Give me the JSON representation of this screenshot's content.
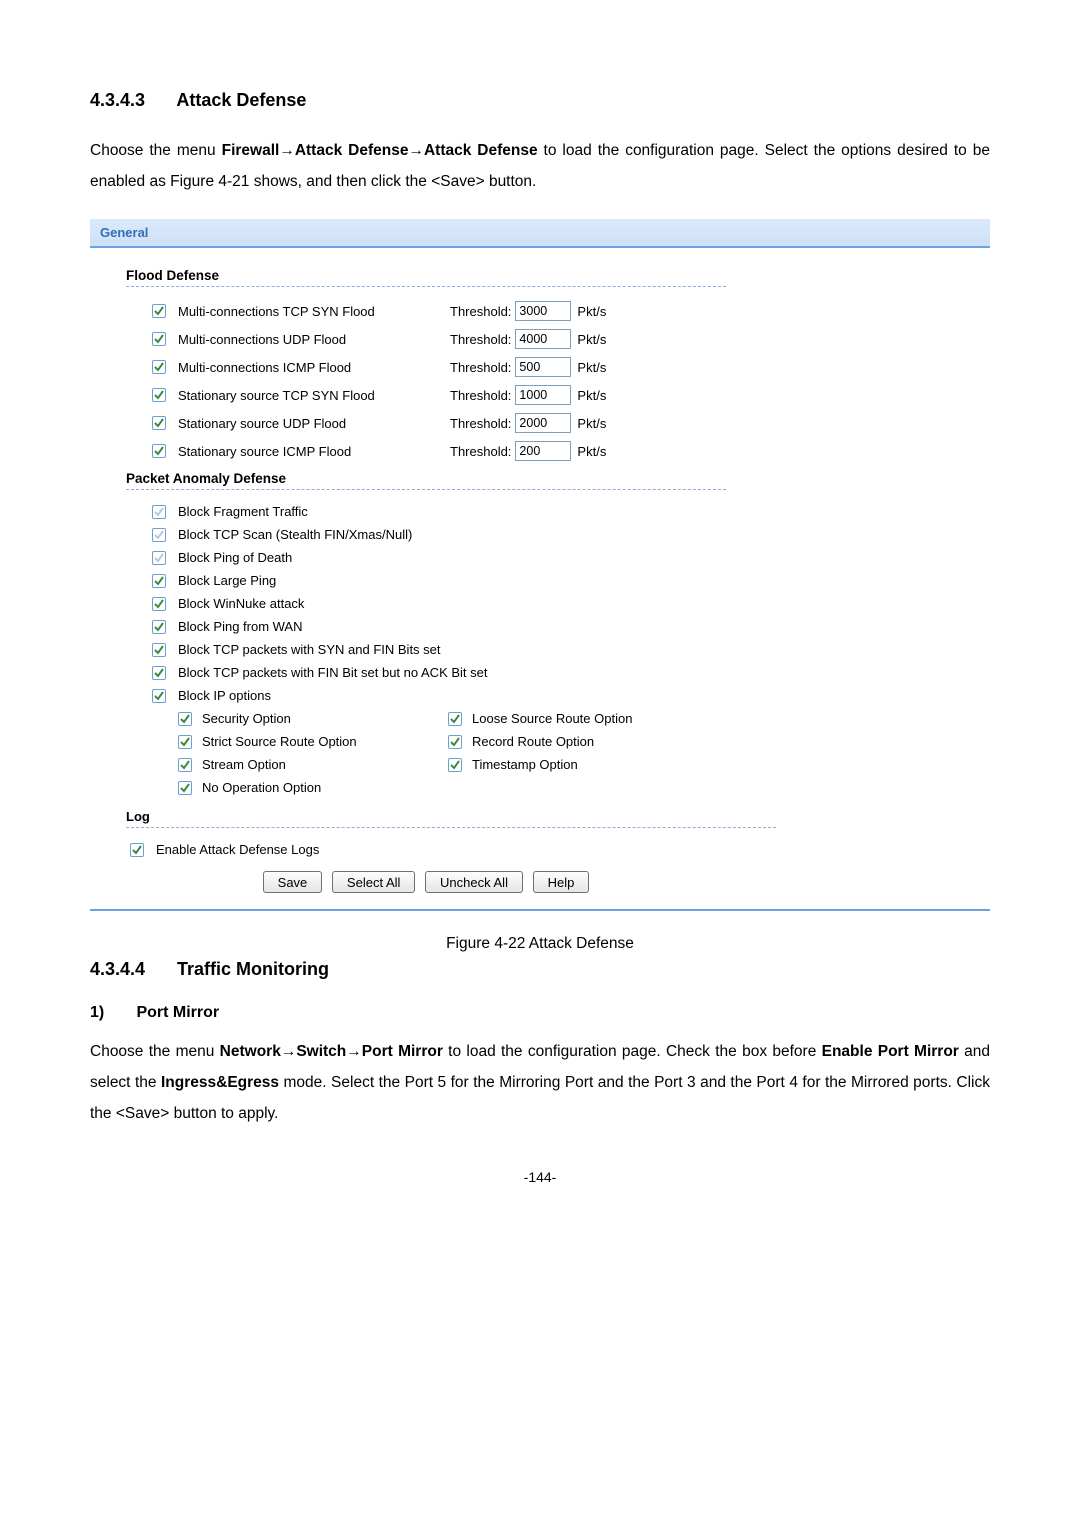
{
  "section1": {
    "number": "4.3.4.3",
    "title": "Attack Defense"
  },
  "para1_a": "Choose the menu ",
  "para1_b": "Firewall",
  "para1_arrow": "→",
  "para1_c": "Attack Defense",
  "para1_d": "Attack Defense",
  "para1_e": " to load the configuration page. Select the options desired to be enabled as Figure 4-21 shows, and then click the <Save> button.",
  "panel": {
    "general": "General",
    "flood_title": "Flood Defense",
    "flood": [
      {
        "label": "Multi-connections TCP SYN Flood",
        "threshold_label": "Threshold:",
        "value": "3000",
        "unit": "Pkt/s"
      },
      {
        "label": "Multi-connections UDP Flood",
        "threshold_label": "Threshold:",
        "value": "4000",
        "unit": "Pkt/s"
      },
      {
        "label": "Multi-connections ICMP Flood",
        "threshold_label": "Threshold:",
        "value": "500",
        "unit": "Pkt/s"
      },
      {
        "label": "Stationary source TCP SYN Flood",
        "threshold_label": "Threshold:",
        "value": "1000",
        "unit": "Pkt/s"
      },
      {
        "label": "Stationary source UDP Flood",
        "threshold_label": "Threshold:",
        "value": "2000",
        "unit": "Pkt/s"
      },
      {
        "label": "Stationary source ICMP Flood",
        "threshold_label": "Threshold:",
        "value": "200",
        "unit": "Pkt/s"
      }
    ],
    "packet_title": "Packet Anomaly Defense",
    "packet": [
      "Block Fragment Traffic",
      "Block TCP Scan (Stealth FIN/Xmas/Null)",
      "Block Ping of Death",
      "Block Large Ping",
      "Block WinNuke attack",
      "Block Ping from WAN",
      "Block TCP packets with SYN and FIN Bits set",
      "Block TCP packets with FIN Bit set but no ACK Bit set",
      "Block IP options"
    ],
    "ip_options": {
      "security": "Security Option",
      "loose": "Loose Source Route Option",
      "strict": "Strict Source Route Option",
      "record": "Record Route Option",
      "stream": "Stream Option",
      "timestamp": "Timestamp Option",
      "noop": "No Operation Option"
    },
    "log_title": "Log",
    "log_label": "Enable Attack Defense Logs",
    "buttons": {
      "save": "Save",
      "select_all": "Select All",
      "uncheck_all": "Uncheck All",
      "help": "Help"
    }
  },
  "figure_caption": "Figure 4-22 Attack Defense",
  "section2": {
    "number": "4.3.4.4",
    "title": "Traffic Monitoring"
  },
  "h4_1": "1)",
  "h4_1_title": "Port Mirror",
  "para2_a": "Choose the menu ",
  "para2_b": "Network",
  "para2_c": "Switch",
  "para2_d": "Port Mirror",
  "para2_e": " to load the configuration page. Check the box before ",
  "para2_f": "Enable Port Mirror",
  "para2_g": " and select the ",
  "para2_h": "Ingress&Egress",
  "para2_i": " mode. Select the Port 5 for the Mirroring Port and the Port 3 and the Port 4 for the Mirrored ports. Click the <Save> button to apply.",
  "page_number": "-144-"
}
